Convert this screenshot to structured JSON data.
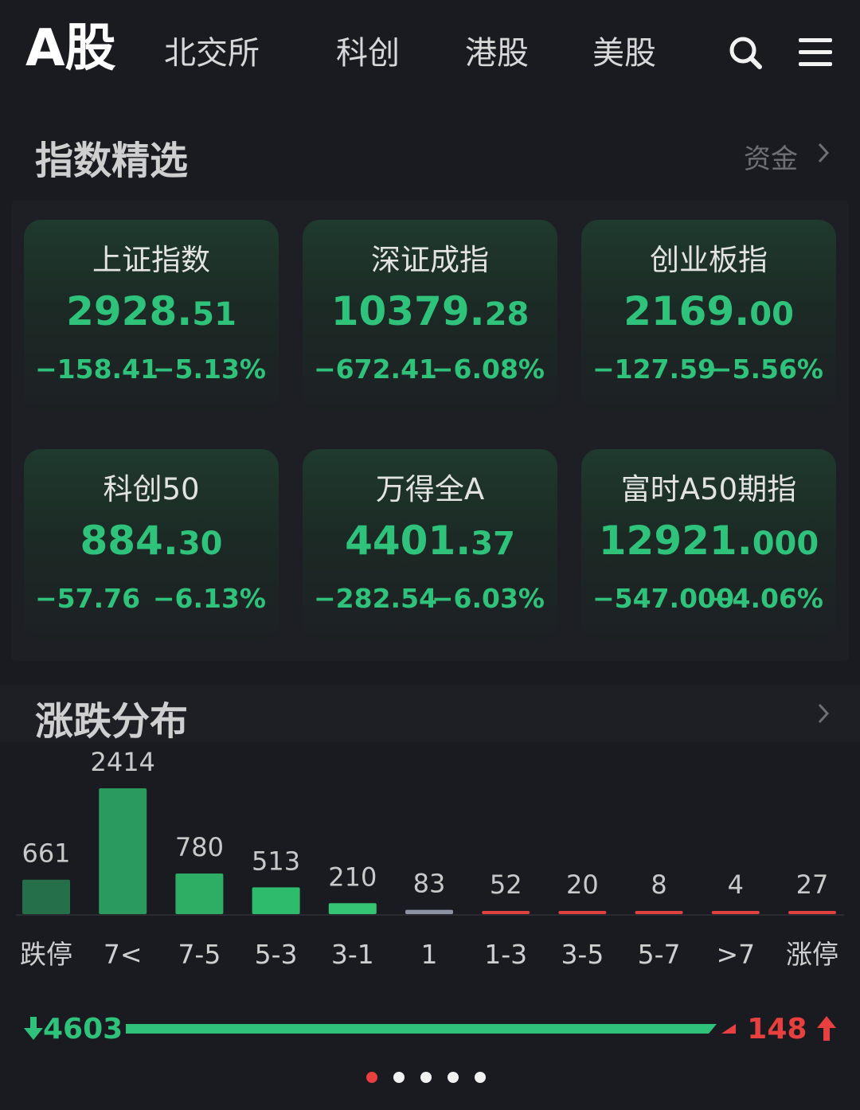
{
  "nav": {
    "tabs": [
      {
        "label": "A股",
        "active": true
      },
      {
        "label": "北交所",
        "active": false
      },
      {
        "label": "科创",
        "active": false
      },
      {
        "label": "港股",
        "active": false
      },
      {
        "label": "美股",
        "active": false
      }
    ],
    "icons": [
      "search-icon",
      "menu-icon"
    ]
  },
  "indices": {
    "title": "指数精选",
    "link": "资金",
    "cards": [
      {
        "name": "上证指数",
        "int": "2928.",
        "dec": "51",
        "change": "−158.41",
        "pct": "−5.13%"
      },
      {
        "name": "深证成指",
        "int": "10379.",
        "dec": "28",
        "change": "−672.41",
        "pct": "−6.08%"
      },
      {
        "name": "创业板指",
        "int": "2169.",
        "dec": "00",
        "change": "−127.59",
        "pct": "−5.56%"
      },
      {
        "name": "科创50",
        "int": "884.",
        "dec": "30",
        "change": "−57.76",
        "pct": "−6.13%"
      },
      {
        "name": "万得全A",
        "int": "4401.",
        "dec": "37",
        "change": "−282.54",
        "pct": "−6.03%"
      },
      {
        "name": "富时A50期指",
        "int": "12921.",
        "dec": "000",
        "change": "−547.000",
        "pct": "−4.06%"
      }
    ]
  },
  "distribution": {
    "title": "涨跌分布",
    "down_total": "4603",
    "up_total": "148",
    "down_ratio": 0.9688
  },
  "chart_data": {
    "type": "bar",
    "title": "涨跌分布",
    "categories": [
      "跌停",
      "7<",
      "7-5",
      "5-3",
      "3-1",
      "1",
      "1-3",
      "3-5",
      "5-7",
      ">7",
      "涨停"
    ],
    "values": [
      661,
      2414,
      780,
      513,
      210,
      83,
      52,
      20,
      8,
      4,
      27
    ],
    "labels": [
      "661",
      "2414",
      "780",
      "513",
      "210",
      "83",
      "52",
      "20",
      "8",
      "4",
      "27"
    ],
    "colors": [
      "#25704a",
      "#2b9a5f",
      "#2ead65",
      "#2fbb6c",
      "#34c474",
      "#8e93a6",
      "#e14141",
      "#e14141",
      "#e14141",
      "#e14141",
      "#e14141"
    ],
    "ylim": [
      0,
      2414
    ]
  },
  "pagination": {
    "count": 5,
    "active": 0
  },
  "colors": {
    "down": "#2ec27b",
    "up": "#e8403f",
    "background": "#1a1b20"
  }
}
